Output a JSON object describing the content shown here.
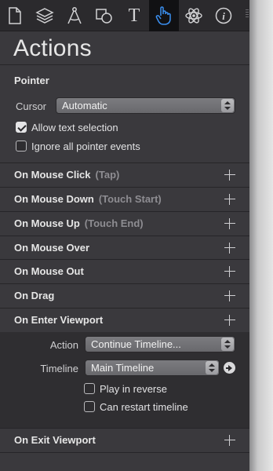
{
  "toolbar": {
    "tools": [
      {
        "name": "document-icon"
      },
      {
        "name": "layers-icon"
      },
      {
        "name": "compass-icon"
      },
      {
        "name": "shapes-icon"
      },
      {
        "name": "text-icon",
        "glyph": "T"
      },
      {
        "name": "hand-pointer-icon",
        "active": true
      },
      {
        "name": "atom-icon"
      },
      {
        "name": "info-icon",
        "glyph": "i"
      }
    ]
  },
  "panel": {
    "title": "Actions"
  },
  "pointer": {
    "heading": "Pointer",
    "cursor_label": "Cursor",
    "cursor_value": "Automatic",
    "allow_text_selection": {
      "label": "Allow text selection",
      "checked": true
    },
    "ignore_pointer_events": {
      "label": "Ignore all pointer events",
      "checked": false
    }
  },
  "events": [
    {
      "name": "On Mouse Click",
      "alt": "(Tap)"
    },
    {
      "name": "On Mouse Down",
      "alt": "(Touch Start)"
    },
    {
      "name": "On Mouse Up",
      "alt": "(Touch End)"
    },
    {
      "name": "On Mouse Over",
      "alt": ""
    },
    {
      "name": "On Mouse Out",
      "alt": ""
    },
    {
      "name": "On Drag",
      "alt": ""
    },
    {
      "name": "On Enter Viewport",
      "alt": ""
    }
  ],
  "enter_viewport": {
    "action_label": "Action",
    "action_value": "Continue Timeline...",
    "timeline_label": "Timeline",
    "timeline_value": "Main Timeline",
    "play_in_reverse": {
      "label": "Play in reverse",
      "checked": false
    },
    "can_restart": {
      "label": "Can restart timeline",
      "checked": false
    }
  },
  "exit_viewport": {
    "name": "On Exit Viewport"
  },
  "colors": {
    "panel_bg": "#3a393d",
    "toolbar_bg": "#2b2a2d",
    "accent_blue": "#3a8ff0"
  }
}
